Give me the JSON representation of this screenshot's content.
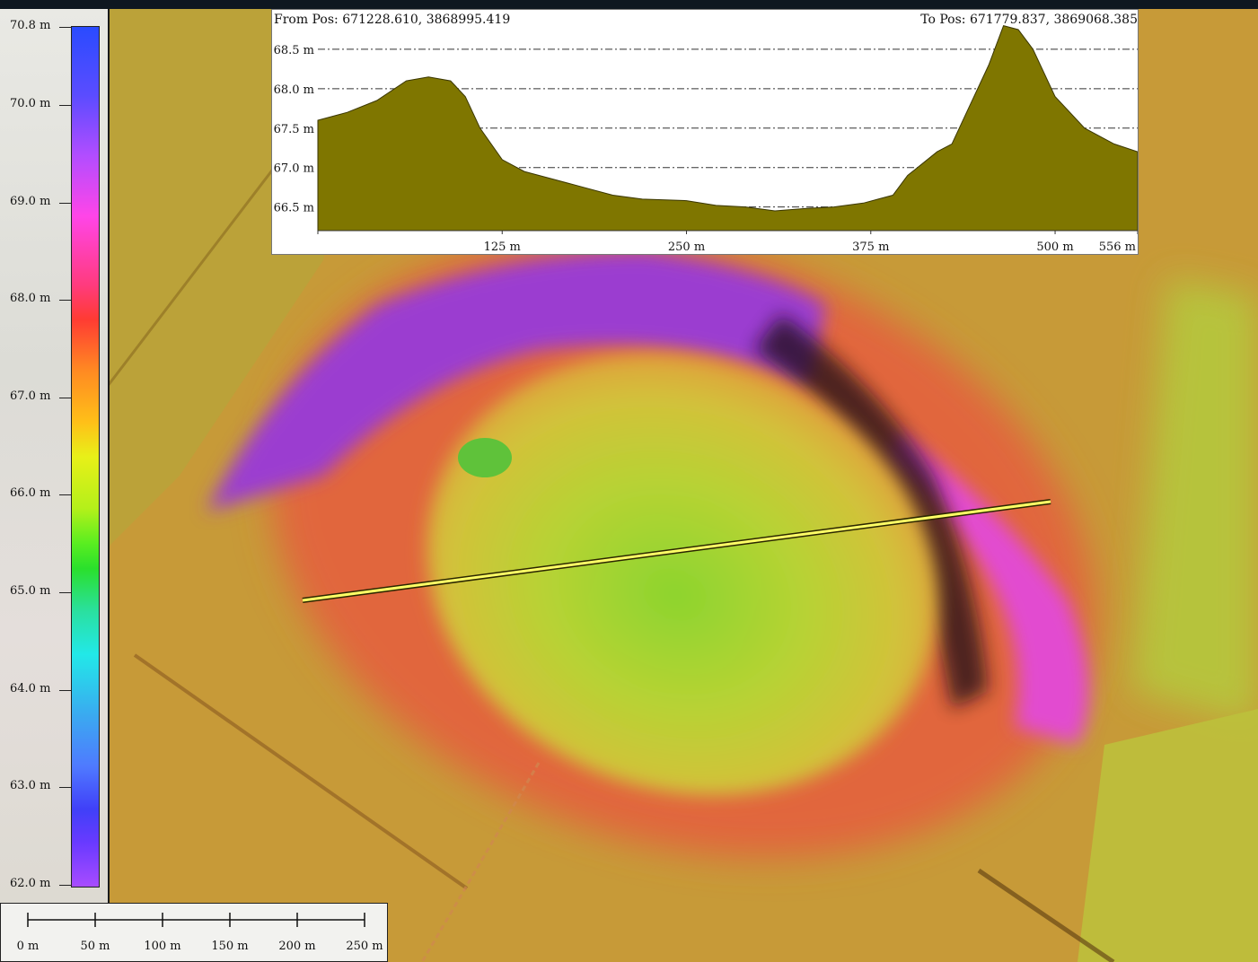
{
  "legend": {
    "labels": [
      "70.8 m",
      "70.0 m",
      "69.0 m",
      "68.0 m",
      "67.0 m",
      "66.0 m",
      "65.0 m",
      "64.0 m",
      "63.0 m",
      "62.0 m"
    ]
  },
  "profile": {
    "from_label": "From Pos: 671228.610, 3868995.419",
    "to_label": "To Pos: 671779.837, 3869068.385",
    "y_labels": [
      "68.5 m",
      "68.0 m",
      "67.5 m",
      "67.0 m",
      "66.5 m"
    ],
    "x_labels": [
      "125 m",
      "250 m",
      "375 m",
      "500 m",
      "556 m"
    ],
    "fill_color": "#7f7600"
  },
  "scale_bar": {
    "labels": [
      "0 m",
      "50 m",
      "100 m",
      "150 m",
      "200 m",
      "250 m"
    ]
  },
  "chart_data": {
    "type": "area",
    "x": [
      0,
      10,
      20,
      40,
      60,
      75,
      90,
      100,
      110,
      125,
      140,
      160,
      180,
      200,
      220,
      250,
      270,
      290,
      310,
      330,
      350,
      370,
      380,
      390,
      400,
      410,
      420,
      430,
      440,
      455,
      465,
      475,
      485,
      500,
      520,
      540,
      556
    ],
    "y": [
      67.6,
      67.65,
      67.7,
      67.85,
      68.1,
      68.15,
      68.1,
      67.9,
      67.5,
      67.1,
      66.95,
      66.85,
      66.75,
      66.65,
      66.6,
      66.58,
      66.52,
      66.5,
      66.45,
      66.48,
      66.5,
      66.55,
      66.6,
      66.65,
      66.9,
      67.05,
      67.2,
      67.3,
      67.7,
      68.3,
      68.8,
      68.75,
      68.5,
      67.9,
      67.5,
      67.3,
      67.2
    ],
    "xlabel": "",
    "ylabel": "",
    "xlim": [
      0,
      556
    ],
    "ylim": [
      66.2,
      69.0
    ],
    "grid": true
  }
}
